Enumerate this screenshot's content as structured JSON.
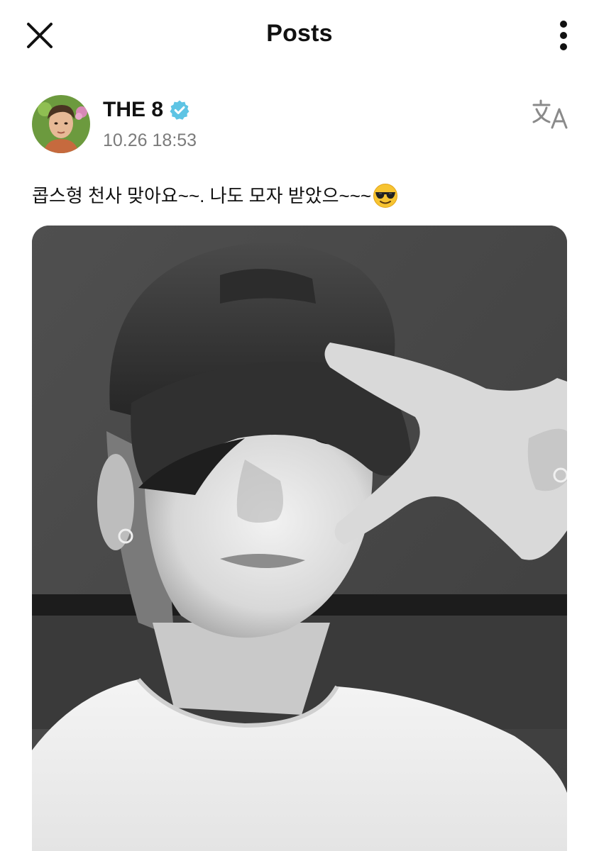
{
  "header": {
    "title": "Posts",
    "close_icon": "close-icon",
    "more_icon": "more-vertical-icon"
  },
  "post": {
    "author": {
      "name": "THE 8",
      "verified_icon": "verified-badge-icon",
      "verified_color": "#5ec4e4"
    },
    "time": "10.26 18:53",
    "translate_icon": "translate-icon",
    "caption": "콥스형 천사 맞아요~~. 나도 모자 받았으~~~",
    "caption_emoji": "smiling-face-with-sunglasses-emoji"
  },
  "colors": {
    "text": "#111111",
    "muted": "#7b7b7b",
    "background": "#ffffff"
  }
}
